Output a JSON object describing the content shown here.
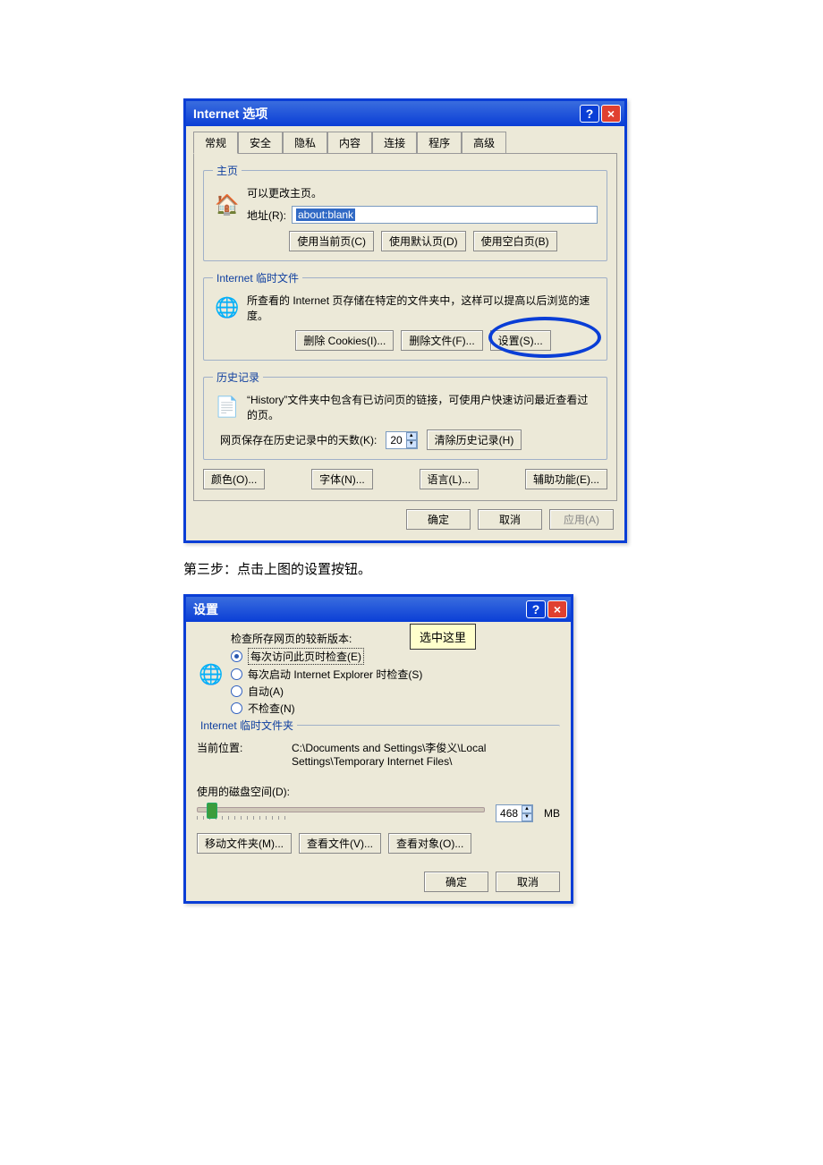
{
  "dialog1": {
    "title": "Internet 选项",
    "tabs": [
      "常规",
      "安全",
      "隐私",
      "内容",
      "连接",
      "程序",
      "高级"
    ],
    "homepage": {
      "legend": "主页",
      "desc": "可以更改主页。",
      "addr_label": "地址(R):",
      "addr_value": "about:blank",
      "btn_current": "使用当前页(C)",
      "btn_default": "使用默认页(D)",
      "btn_blank": "使用空白页(B)"
    },
    "tempfiles": {
      "legend": "Internet 临时文件",
      "desc": "所查看的 Internet 页存储在特定的文件夹中，这样可以提高以后浏览的速度。",
      "btn_delcookies": "删除 Cookies(I)...",
      "btn_delfiles": "删除文件(F)...",
      "btn_settings": "设置(S)..."
    },
    "history": {
      "legend": "历史记录",
      "desc": "“History”文件夹中包含有已访问页的链接，可使用户快速访问最近查看过的页。",
      "days_label": "网页保存在历史记录中的天数(K):",
      "days_value": "20",
      "btn_clear": "清除历史记录(H)"
    },
    "bottom": {
      "colors": "颜色(O)...",
      "fonts": "字体(N)...",
      "lang": "语言(L)...",
      "access": "辅助功能(E)..."
    },
    "commit": {
      "ok": "确定",
      "cancel": "取消",
      "apply": "应用(A)"
    }
  },
  "doc_line": "第三步：点击上图的设置按钮。",
  "dialog2": {
    "title": "设置",
    "callout": "选中这里",
    "check_label": "检查所存网页的较新版本:",
    "radios": {
      "every_visit": "每次访问此页时检查(E)",
      "every_start": "每次启动 Internet Explorer 时检查(S)",
      "auto": "自动(A)",
      "never": "不检查(N)"
    },
    "tempfolder": {
      "legend": "Internet 临时文件夹",
      "loc_label": "当前位置:",
      "loc_value": "C:\\Documents and Settings\\李俊义\\Local Settings\\Temporary Internet Files\\",
      "disk_label": "使用的磁盘空间(D):",
      "disk_value": "468",
      "disk_unit": "MB",
      "btn_move": "移动文件夹(M)...",
      "btn_view": "查看文件(V)...",
      "btn_obj": "查看对象(O)..."
    },
    "commit": {
      "ok": "确定",
      "cancel": "取消"
    }
  }
}
